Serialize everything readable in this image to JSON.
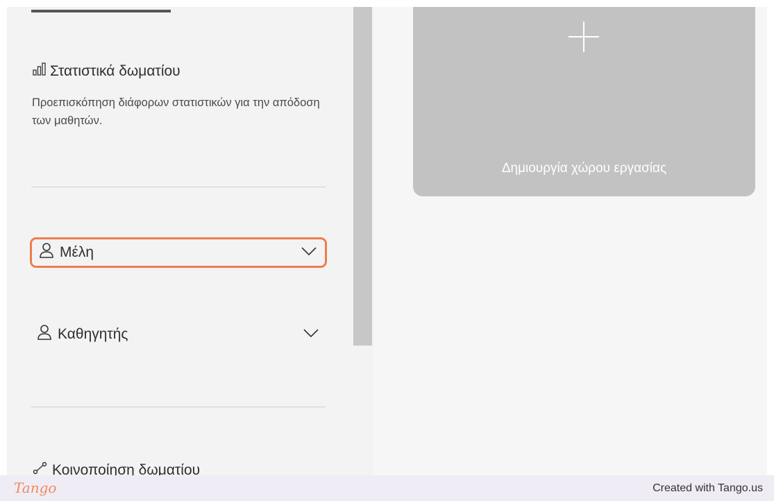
{
  "sidebar": {
    "stats": {
      "title": "Στατιστικά δωματίου",
      "description": "Προεπισκόπηση διάφορων στατιστικών για την απόδοση των μαθητών."
    },
    "members": {
      "label": "Μέλη"
    },
    "teacher": {
      "label": "Καθηγητής"
    },
    "share": {
      "label": "Κοινοποίηση δωματίου"
    }
  },
  "main": {
    "create_workspace": {
      "label": "Δημιουργία χώρου εργασίας"
    }
  },
  "footer": {
    "brand": "Tango",
    "credit": "Created with Tango.us"
  },
  "colors": {
    "highlight": "#ef7d4a",
    "card": "#c2c2c2",
    "sidebar": "#f3f3f3"
  }
}
